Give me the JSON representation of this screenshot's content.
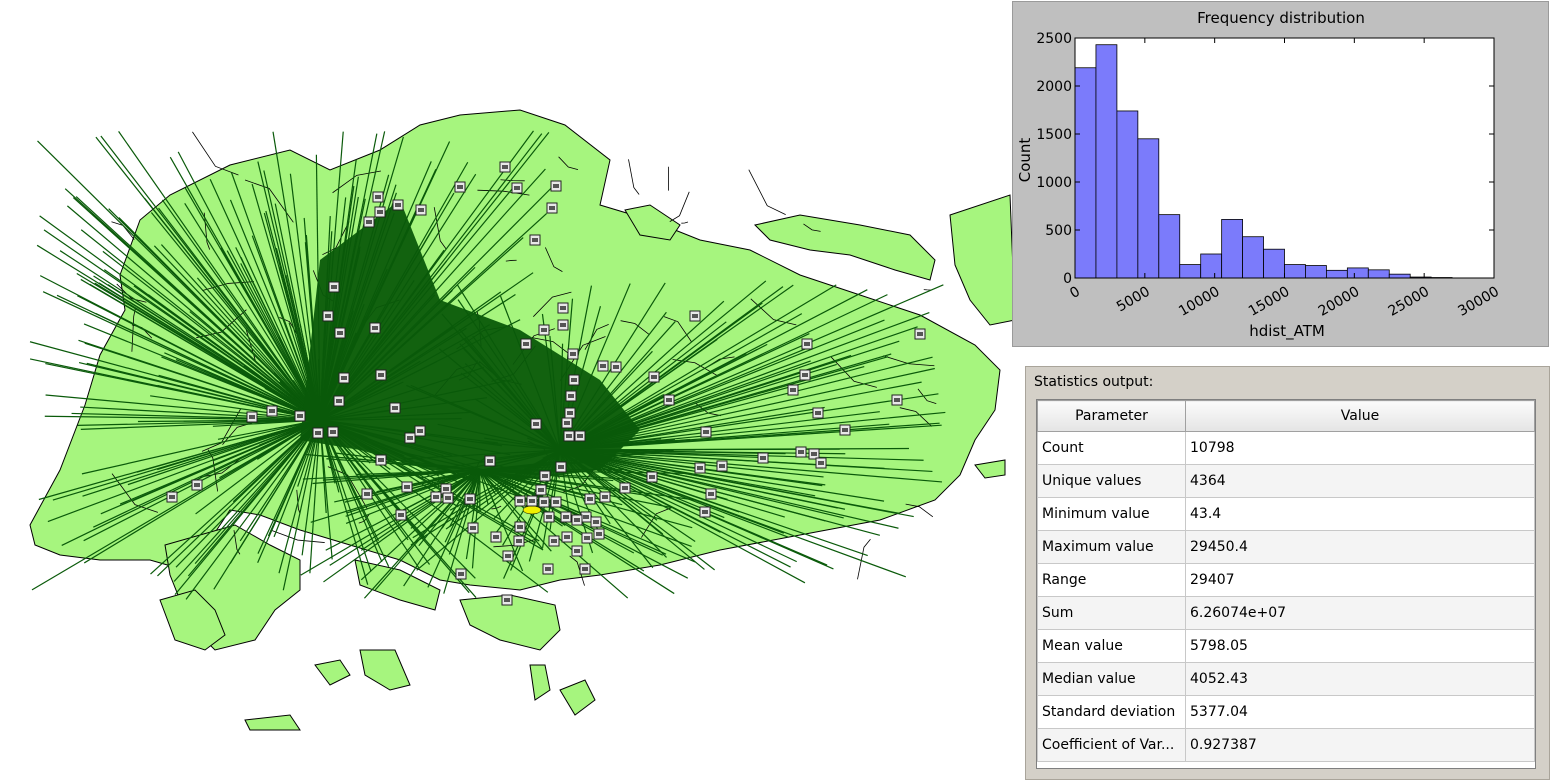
{
  "map": {
    "land_color": "#a6f57e",
    "land_stroke": "#000000",
    "line_color": "#0a5a0a",
    "highlight_color": "#f0f000",
    "marker_icon": "atm-icon",
    "marker_count": 104
  },
  "chart_data": {
    "type": "bar",
    "title": "Frequency distribution",
    "xlabel": "hdist_ATM",
    "ylabel": "Count",
    "bar_color": "#7b7bfb",
    "bin_width": 1500,
    "x_start": 0,
    "values": [
      2190,
      2430,
      1740,
      1450,
      660,
      140,
      250,
      610,
      430,
      300,
      140,
      130,
      80,
      105,
      85,
      40,
      10,
      5
    ],
    "xlim": [
      0,
      30000
    ],
    "ylim": [
      0,
      2500
    ],
    "xticks": [
      0,
      5000,
      10000,
      15000,
      20000,
      25000,
      30000
    ],
    "yticks": [
      0,
      500,
      1000,
      1500,
      2000,
      2500
    ],
    "grid": false
  },
  "stats": {
    "label": "Statistics output:",
    "headers": [
      "Parameter",
      "Value"
    ],
    "rows": [
      {
        "param": "Count",
        "value": "10798"
      },
      {
        "param": "Unique values",
        "value": "4364"
      },
      {
        "param": "Minimum value",
        "value": "43.4"
      },
      {
        "param": "Maximum value",
        "value": "29450.4"
      },
      {
        "param": "Range",
        "value": "29407"
      },
      {
        "param": "Sum",
        "value": "6.26074e+07"
      },
      {
        "param": "Mean value",
        "value": "5798.05"
      },
      {
        "param": "Median value",
        "value": "4052.43"
      },
      {
        "param": "Standard deviation",
        "value": "5377.04"
      },
      {
        "param": "Coefficient of Var...",
        "value": "0.927387"
      }
    ]
  }
}
